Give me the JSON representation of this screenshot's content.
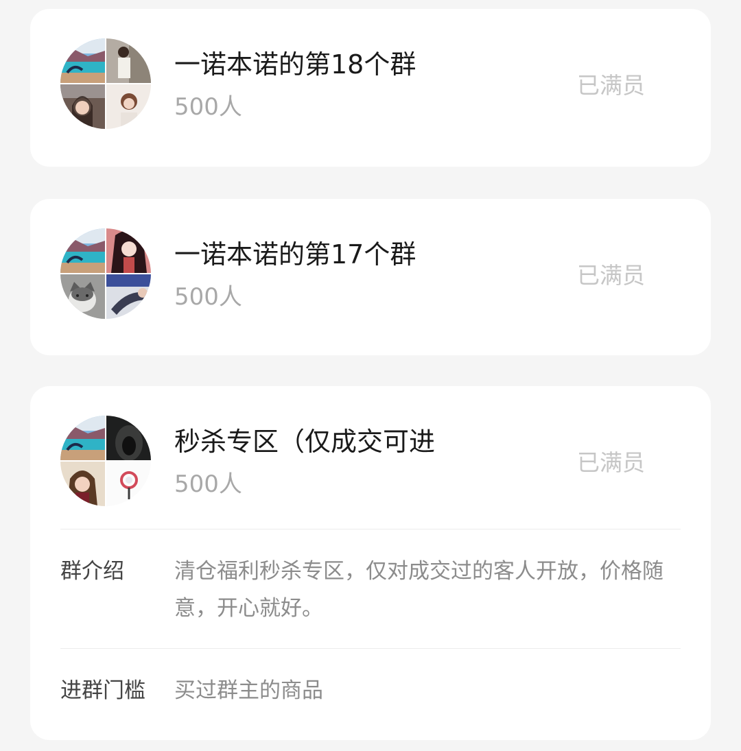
{
  "groups": [
    {
      "name": "一诺本诺的第18个群",
      "count": "500人",
      "status": "已满员",
      "avatar_tiles": [
        "lake-landscape-photo",
        "person-in-room-photo",
        "woman-selfie-photo",
        "girl-portrait-photo"
      ]
    },
    {
      "name": "一诺本诺的第17个群",
      "count": "500人",
      "status": "已满员",
      "avatar_tiles": [
        "lake-landscape-photo",
        "anime-girl-photo",
        "cat-photo",
        "person-lying-photo"
      ]
    },
    {
      "name": "秒杀专区（仅成交可进",
      "count": "500人",
      "status": "已满员",
      "avatar_tiles": [
        "lake-landscape-photo",
        "dark-cave-photo",
        "woman-selfie-photo",
        "lollipop-icon"
      ]
    }
  ],
  "details": {
    "intro_label": "群介绍",
    "intro_text": "清仓福利秒杀专区，仅对成交过的客人开放，价格随意，开心就好。",
    "threshold_label": "进群门槛",
    "threshold_text": "买过群主的商品"
  },
  "colors": {
    "page_background": "#f5f5f5",
    "card_background": "#ffffff",
    "title_text": "#1a1a1a",
    "count_text": "#a8a8a8",
    "status_text": "#c6c6c6"
  }
}
